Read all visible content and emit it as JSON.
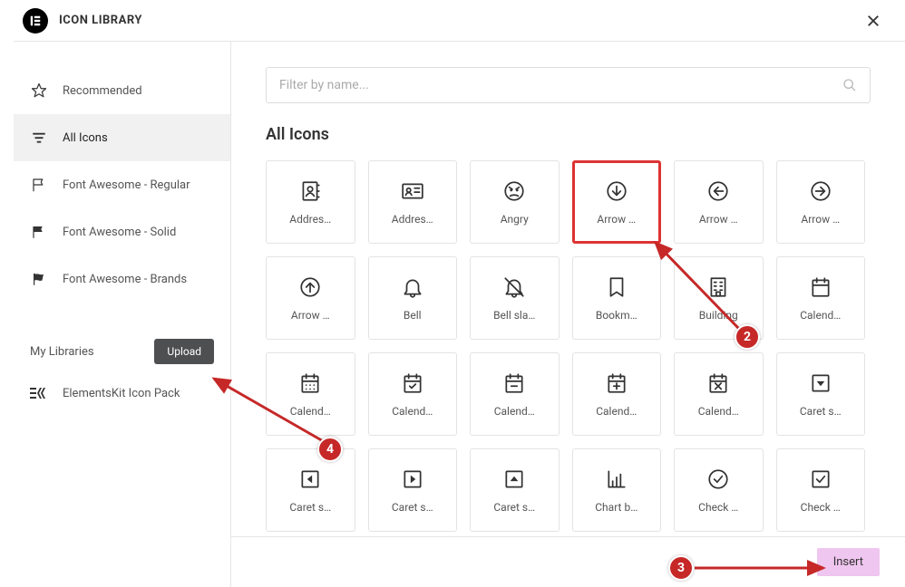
{
  "header": {
    "title": "ICON LIBRARY"
  },
  "sidebar": {
    "items": [
      {
        "label": "Recommended",
        "icon": "star"
      },
      {
        "label": "All Icons",
        "icon": "filter",
        "active": true
      },
      {
        "label": "Font Awesome - Regular",
        "icon": "flag-regular"
      },
      {
        "label": "Font Awesome - Solid",
        "icon": "flag-solid"
      },
      {
        "label": "Font Awesome - Brands",
        "icon": "flag-brands"
      }
    ],
    "my_libraries_label": "My Libraries",
    "upload_label": "Upload",
    "libs": [
      {
        "label": "ElementsKit Icon Pack",
        "icon": "ek"
      }
    ]
  },
  "search": {
    "placeholder": "Filter by name..."
  },
  "section_title": "All Icons",
  "icons": [
    {
      "label": "Addres…",
      "glyph": "address-book"
    },
    {
      "label": "Addres…",
      "glyph": "address-card"
    },
    {
      "label": "Angry",
      "glyph": "angry"
    },
    {
      "label": "Arrow …",
      "glyph": "arrow-down-circle",
      "selected": true
    },
    {
      "label": "Arrow …",
      "glyph": "arrow-left-circle"
    },
    {
      "label": "Arrow …",
      "glyph": "arrow-right-circle"
    },
    {
      "label": "Arrow …",
      "glyph": "arrow-up-circle"
    },
    {
      "label": "Bell",
      "glyph": "bell"
    },
    {
      "label": "Bell sla…",
      "glyph": "bell-slash"
    },
    {
      "label": "Bookm…",
      "glyph": "bookmark"
    },
    {
      "label": "Building",
      "glyph": "building"
    },
    {
      "label": "Calend…",
      "glyph": "calendar"
    },
    {
      "label": "Calend…",
      "glyph": "calendar-alt"
    },
    {
      "label": "Calend…",
      "glyph": "calendar-check"
    },
    {
      "label": "Calend…",
      "glyph": "calendar-minus"
    },
    {
      "label": "Calend…",
      "glyph": "calendar-plus"
    },
    {
      "label": "Calend…",
      "glyph": "calendar-times"
    },
    {
      "label": "Caret s…",
      "glyph": "caret-sq-down"
    },
    {
      "label": "Caret s…",
      "glyph": "caret-sq-left"
    },
    {
      "label": "Caret s…",
      "glyph": "caret-sq-right"
    },
    {
      "label": "Caret s…",
      "glyph": "caret-sq-up"
    },
    {
      "label": "Chart b…",
      "glyph": "chart-bar"
    },
    {
      "label": "Check …",
      "glyph": "check-circle"
    },
    {
      "label": "Check …",
      "glyph": "check-square"
    }
  ],
  "footer": {
    "insert_label": "Insert"
  },
  "annotations": {
    "b2": "2",
    "b3": "3",
    "b4": "4"
  }
}
